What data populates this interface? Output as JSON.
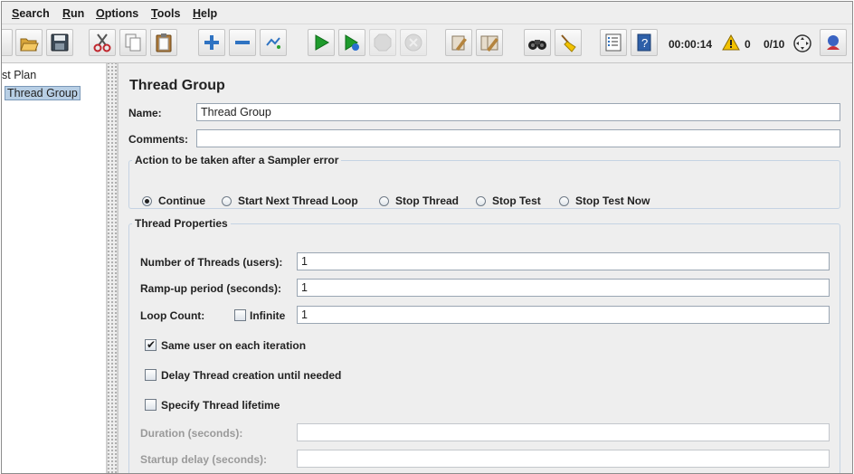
{
  "menu": {
    "items": [
      {
        "label": "Search",
        "mnemonic": "S",
        "rest": "earch"
      },
      {
        "label": "Run",
        "mnemonic": "R",
        "rest": "un"
      },
      {
        "label": "Options",
        "mnemonic": "O",
        "rest": "ptions"
      },
      {
        "label": "Tools",
        "mnemonic": "T",
        "rest": "ools"
      },
      {
        "label": "Help",
        "mnemonic": "H",
        "rest": "elp"
      }
    ]
  },
  "toolbar": {
    "icons": [
      "open-icon",
      "save-icon",
      "cut-icon",
      "copy-icon",
      "paste-icon",
      "expand-icon",
      "collapse-icon",
      "toggle-icon",
      "start-icon",
      "start-no-pauses-icon",
      "stop-icon",
      "shutdown-icon",
      "clear-icon",
      "clear-all-icon",
      "search-icon",
      "reset-search-icon",
      "function-helper-icon",
      "help-icon",
      "remote-icon"
    ],
    "timer": "00:00:14",
    "warning_count": "0",
    "threads": "0/10",
    "accent_green": "#1e9b2c",
    "warning_color": "#f2c200"
  },
  "tree": {
    "root_label": "st Plan",
    "child_label": "Thread Group"
  },
  "panel": {
    "title": "Thread Group",
    "name_label": "Name:",
    "name_value": "Thread Group",
    "comments_label": "Comments:",
    "comments_value": "",
    "action_legend": "Action to be taken after a Sampler error",
    "actions": [
      {
        "label": "Continue",
        "checked": true
      },
      {
        "label": "Start Next Thread Loop",
        "checked": false
      },
      {
        "label": "Stop Thread",
        "checked": false
      },
      {
        "label": "Stop Test",
        "checked": false
      },
      {
        "label": "Stop Test Now",
        "checked": false
      }
    ],
    "props_legend": "Thread Properties",
    "threads_label": "Number of Threads (users):",
    "threads_value": "1",
    "rampup_label": "Ramp-up period (seconds):",
    "rampup_value": "1",
    "loop_label": "Loop Count:",
    "infinite_label": "Infinite",
    "infinite_checked": false,
    "loop_value": "1",
    "same_user_label": "Same user on each iteration",
    "same_user_checked": true,
    "delay_label": "Delay Thread creation until needed",
    "delay_checked": false,
    "lifetime_label": "Specify Thread lifetime",
    "lifetime_checked": false,
    "duration_label": "Duration (seconds):",
    "duration_value": "",
    "startup_label": "Startup delay (seconds):",
    "startup_value": ""
  }
}
